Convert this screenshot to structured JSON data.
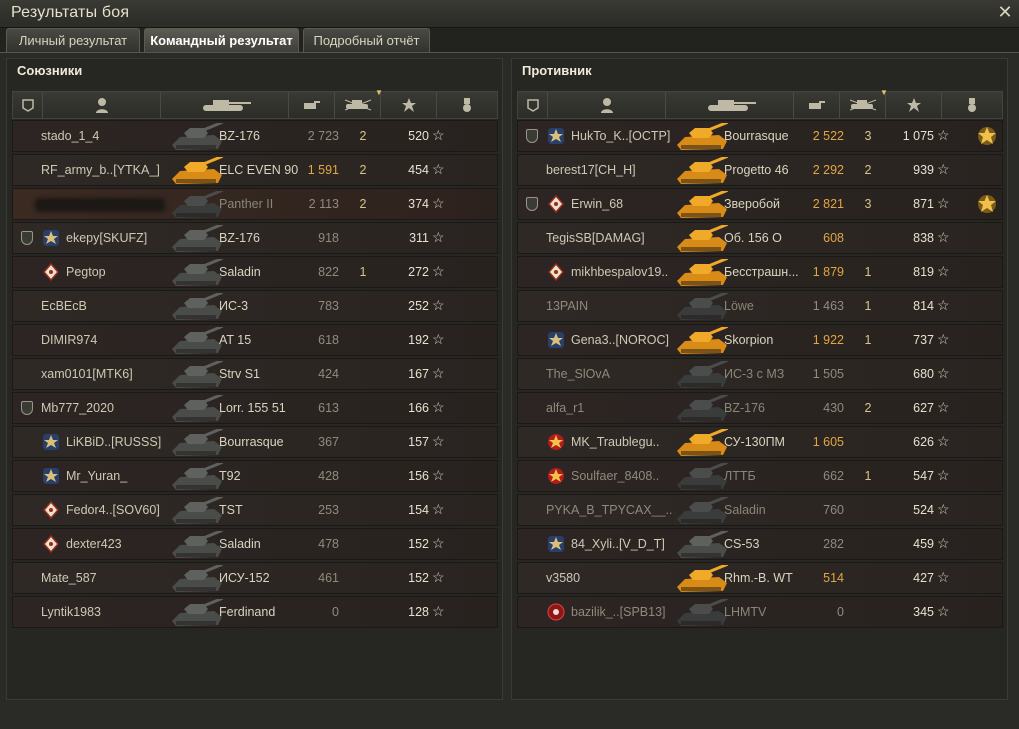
{
  "window": {
    "title": "Результаты боя",
    "close_icon": "close-icon"
  },
  "tabs": [
    {
      "label": "Личный результат",
      "active": false
    },
    {
      "label": "Командный результат",
      "active": true
    },
    {
      "label": "Подробный отчёт",
      "active": false
    }
  ],
  "allies": {
    "title": "Союзники",
    "rows": [
      {
        "name": "stado_1_4",
        "vehicle": "BZ-176",
        "damage": "2 723",
        "kills": "2",
        "xp": "520",
        "dim": false,
        "gold": false,
        "badge": false,
        "emblem": "",
        "highlight": false
      },
      {
        "name": "RF_army_b..[YTKA_]",
        "vehicle": "ELC EVEN 90",
        "damage": "1 591",
        "kills": "2",
        "xp": "454",
        "dim": false,
        "gold": true,
        "badge": false,
        "emblem": ""
      },
      {
        "name": "",
        "vehicle": "Panther II",
        "damage": "2 113",
        "kills": "2",
        "xp": "374",
        "dim": true,
        "gold": false,
        "badge": false,
        "emblem": "",
        "highlight": true
      },
      {
        "name": "ekepy[SKUFZ]",
        "vehicle": "BZ-176",
        "damage": "918",
        "kills": "",
        "xp": "311",
        "dim": false,
        "gold": false,
        "badge": true,
        "emblem": "clan-emblem-icon"
      },
      {
        "name": "Pegtop",
        "vehicle": "Saladin",
        "damage": "822",
        "kills": "1",
        "xp": "272",
        "dim": false,
        "gold": false,
        "badge": false,
        "emblem": "clan-diamond-icon"
      },
      {
        "name": "EcBEcB",
        "vehicle": "ИС-3",
        "damage": "783",
        "kills": "",
        "xp": "252",
        "dim": false,
        "gold": false,
        "badge": false,
        "emblem": ""
      },
      {
        "name": "DIMIR974",
        "vehicle": "AT 15",
        "damage": "618",
        "kills": "",
        "xp": "192",
        "dim": false,
        "gold": false,
        "badge": false,
        "emblem": ""
      },
      {
        "name": "xam0101[MTK6]",
        "vehicle": "Strv S1",
        "damage": "424",
        "kills": "",
        "xp": "167",
        "dim": false,
        "gold": false,
        "badge": false,
        "emblem": ""
      },
      {
        "name": "Mb777_2020",
        "vehicle": "Lorr. 155 51",
        "damage": "613",
        "kills": "",
        "xp": "166",
        "dim": false,
        "gold": false,
        "badge": true,
        "emblem": ""
      },
      {
        "name": "LiKBiD..[RUSSS]",
        "vehicle": "Bourrasque",
        "damage": "367",
        "kills": "",
        "xp": "157",
        "dim": false,
        "gold": false,
        "badge": false,
        "emblem": "clan-emblem-icon"
      },
      {
        "name": "Mr_Yuran_",
        "vehicle": "T92",
        "damage": "428",
        "kills": "",
        "xp": "156",
        "dim": false,
        "gold": false,
        "badge": false,
        "emblem": "clan-emblem-icon"
      },
      {
        "name": "Fedor4..[SOV60]",
        "vehicle": "TST",
        "damage": "253",
        "kills": "",
        "xp": "154",
        "dim": false,
        "gold": false,
        "badge": false,
        "emblem": "clan-diamond-icon"
      },
      {
        "name": "dexter423",
        "vehicle": "Saladin",
        "damage": "478",
        "kills": "",
        "xp": "152",
        "dim": false,
        "gold": false,
        "badge": false,
        "emblem": "clan-diamond-icon"
      },
      {
        "name": "Mate_587",
        "vehicle": "ИСУ-152",
        "damage": "461",
        "kills": "",
        "xp": "152",
        "dim": false,
        "gold": false,
        "badge": false,
        "emblem": ""
      },
      {
        "name": "Lyntik1983",
        "vehicle": "Ferdinand",
        "damage": "0",
        "kills": "",
        "xp": "128",
        "dim": false,
        "gold": false,
        "badge": false,
        "emblem": ""
      }
    ]
  },
  "enemies": {
    "title": "Противник",
    "rows": [
      {
        "name": "HukTo_K..[OCTP]",
        "vehicle": "Bourrasque",
        "damage": "2 522",
        "kills": "3",
        "xp": "1 075",
        "dim": false,
        "gold": true,
        "badge": true,
        "emblem": "clan-emblem-icon",
        "medal": true
      },
      {
        "name": "berest17[CH_H]",
        "vehicle": "Progetto 46",
        "damage": "2 292",
        "kills": "2",
        "xp": "939",
        "dim": false,
        "gold": true,
        "badge": false,
        "emblem": ""
      },
      {
        "name": "Erwin_68",
        "vehicle": "Зверобой",
        "damage": "2 821",
        "kills": "3",
        "xp": "871",
        "dim": false,
        "gold": true,
        "badge": true,
        "emblem": "clan-diamond-icon",
        "medal": true
      },
      {
        "name": "TegisSB[DAMAG]",
        "vehicle": "Об. 156 О",
        "damage": "608",
        "kills": "",
        "xp": "838",
        "dim": false,
        "gold": true,
        "badge": false,
        "emblem": ""
      },
      {
        "name": "mikhbespalov19..",
        "vehicle": "Бесстрашн...",
        "damage": "1 879",
        "kills": "1",
        "xp": "819",
        "dim": false,
        "gold": true,
        "badge": false,
        "emblem": "clan-diamond-icon"
      },
      {
        "name": "13PAIN",
        "vehicle": "Löwe",
        "damage": "1 463",
        "kills": "1",
        "xp": "814",
        "dim": true,
        "gold": false,
        "badge": false,
        "emblem": ""
      },
      {
        "name": "Gena3..[NOROC]",
        "vehicle": "Skorpion",
        "damage": "1 922",
        "kills": "1",
        "xp": "737",
        "dim": false,
        "gold": true,
        "badge": false,
        "emblem": "clan-emblem-icon"
      },
      {
        "name": "The_SlOvA",
        "vehicle": "ИС-3 с МЗ",
        "damage": "1 505",
        "kills": "",
        "xp": "680",
        "dim": true,
        "gold": false,
        "badge": false,
        "emblem": ""
      },
      {
        "name": "alfa_r1",
        "vehicle": "BZ-176",
        "damage": "430",
        "kills": "2",
        "xp": "627",
        "dim": true,
        "gold": false,
        "badge": false,
        "emblem": ""
      },
      {
        "name": "MK_Traublegu..",
        "vehicle": "СУ-130ПМ",
        "damage": "1 605",
        "kills": "",
        "xp": "626",
        "dim": false,
        "gold": true,
        "badge": false,
        "emblem": "clan-star-icon"
      },
      {
        "name": "Soulfaer_8408..",
        "vehicle": "ЛТТБ",
        "damage": "662",
        "kills": "1",
        "xp": "547",
        "dim": true,
        "gold": false,
        "badge": false,
        "emblem": "clan-star-icon"
      },
      {
        "name": "PYKA_B_TPYCAX__..",
        "vehicle": "Saladin",
        "damage": "760",
        "kills": "",
        "xp": "524",
        "dim": true,
        "gold": false,
        "badge": false,
        "emblem": ""
      },
      {
        "name": "84_Xyli..[V_D_T]",
        "vehicle": "CS-53",
        "damage": "282",
        "kills": "",
        "xp": "459",
        "dim": false,
        "gold": false,
        "badge": false,
        "emblem": "clan-emblem-icon"
      },
      {
        "name": "v3580",
        "vehicle": "Rhm.-B. WT",
        "damage": "514",
        "kills": "",
        "xp": "427",
        "dim": false,
        "gold": true,
        "badge": false,
        "emblem": ""
      },
      {
        "name": "bazilik_..[SPB13]",
        "vehicle": "LHMTV",
        "damage": "0",
        "kills": "",
        "xp": "345",
        "dim": true,
        "gold": false,
        "badge": false,
        "emblem": "clan-circle-icon"
      }
    ]
  },
  "header_icons": [
    "squad-icon",
    "player-icon",
    "tank-icon",
    "damage-icon",
    "kills-icon",
    "xp-star-icon",
    "medal-icon"
  ],
  "colors": {
    "gold": "#e3a642",
    "tank_gold": "#d98b17",
    "tank_dark": "#3c3f3e"
  }
}
